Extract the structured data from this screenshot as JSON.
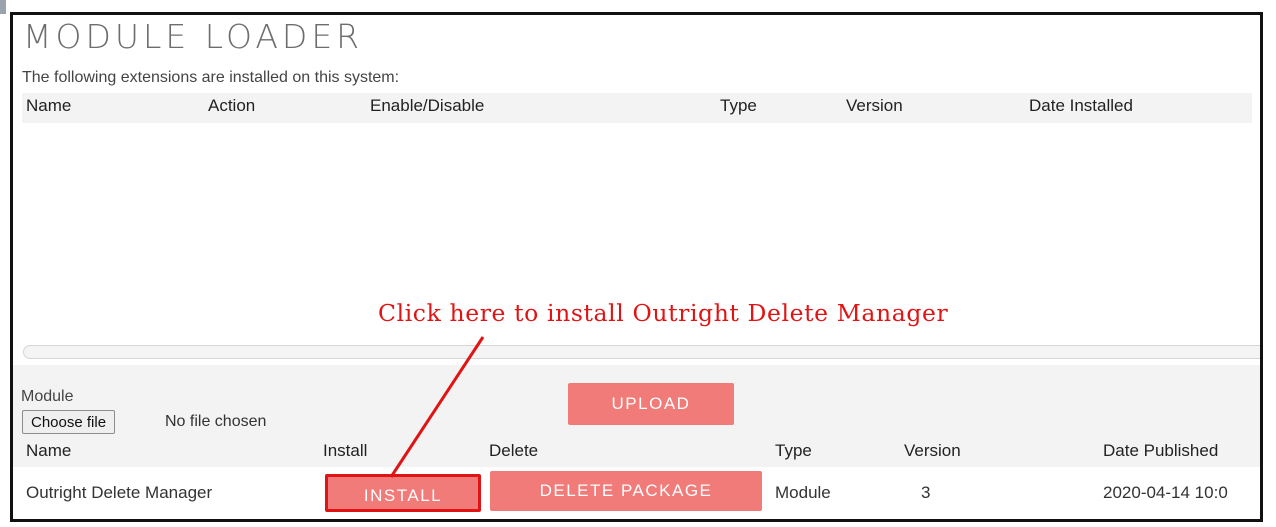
{
  "page": {
    "title": "MODULE LOADER"
  },
  "installed": {
    "caption": "The following extensions are installed on this system:",
    "columns": [
      "Name",
      "Action",
      "Enable/Disable",
      "Type",
      "Version",
      "Date Installed"
    ]
  },
  "upload": {
    "module_label": "Module",
    "choose_file_label": "Choose file",
    "no_file_text": "No file chosen",
    "upload_label": "UPLOAD"
  },
  "available": {
    "columns": [
      "Name",
      "Install",
      "Delete",
      "Type",
      "Version",
      "Date Published"
    ],
    "rows": [
      {
        "name": "Outright Delete Manager",
        "install_label": "INSTALL",
        "delete_label": "DELETE PACKAGE",
        "type": "Module",
        "version": "3",
        "date_published": "2020-04-14 10:0"
      }
    ]
  },
  "annotation": {
    "text": "Click here to install Outright Delete Manager",
    "color": "#e01414"
  },
  "colors": {
    "accent": "#f07b78",
    "highlight": "#e01414",
    "header_bg": "#f3f3f3"
  }
}
